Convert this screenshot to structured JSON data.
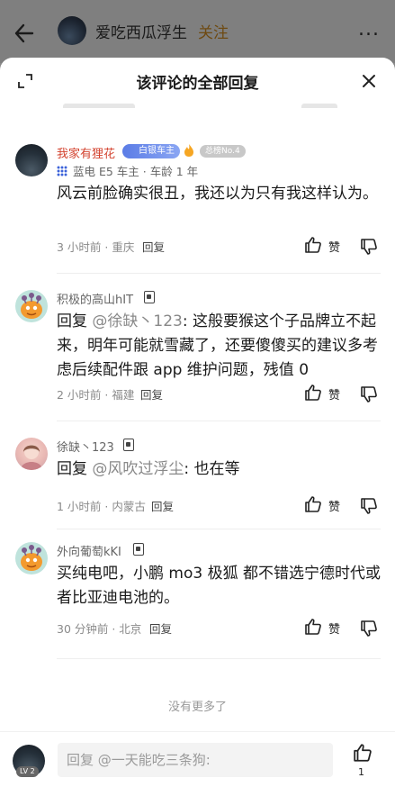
{
  "background": {
    "author_name": "爱吃西瓜浮生",
    "follow_label": "关注",
    "more_label": "..."
  },
  "sheet": {
    "title": "该评论的全部回复"
  },
  "comments": [
    {
      "username": "我家有狸花",
      "badge_label": "白银车主",
      "badge_grey": "总榜No.4",
      "owner_line": "蓝电 E5 车主 · 车龄 1 年",
      "text": "风云前脸确实很丑，我还以为只有我这样认为。",
      "meta": "3 小时前 · 重庆",
      "reply_label": "回复",
      "like_label": "赞"
    },
    {
      "username": "积极的高山hIT",
      "reply_prefix": "回复 ",
      "reply_target": "@徐缺丶123",
      "text": ": 这般要猴这个子品牌立不起来，明年可能就雪藏了，还要傻傻买的建议多考虑后续配件跟 app 维护问题，残值 0",
      "meta": "2 小时前 · 福建",
      "reply_label": "回复",
      "like_label": "赞"
    },
    {
      "username": "徐缺丶123",
      "reply_prefix": "回复 ",
      "reply_target": "@风吹过浮尘",
      "text": ": 也在等",
      "meta": "1 小时前 · 内蒙古",
      "reply_label": "回复",
      "like_label": "赞"
    },
    {
      "username": "外向葡萄kKI",
      "text": "买纯电吧，小鹏 mo3 极狐 都不错选宁德时代或者比亚迪电池的。",
      "meta": "30 分钟前 · 北京",
      "reply_label": "回复",
      "like_label": "赞"
    }
  ],
  "no_more": "没有更多了",
  "bottom": {
    "level": "LV 2",
    "input_placeholder": "回复 @一天能吃三条狗:",
    "like_count": "1"
  }
}
